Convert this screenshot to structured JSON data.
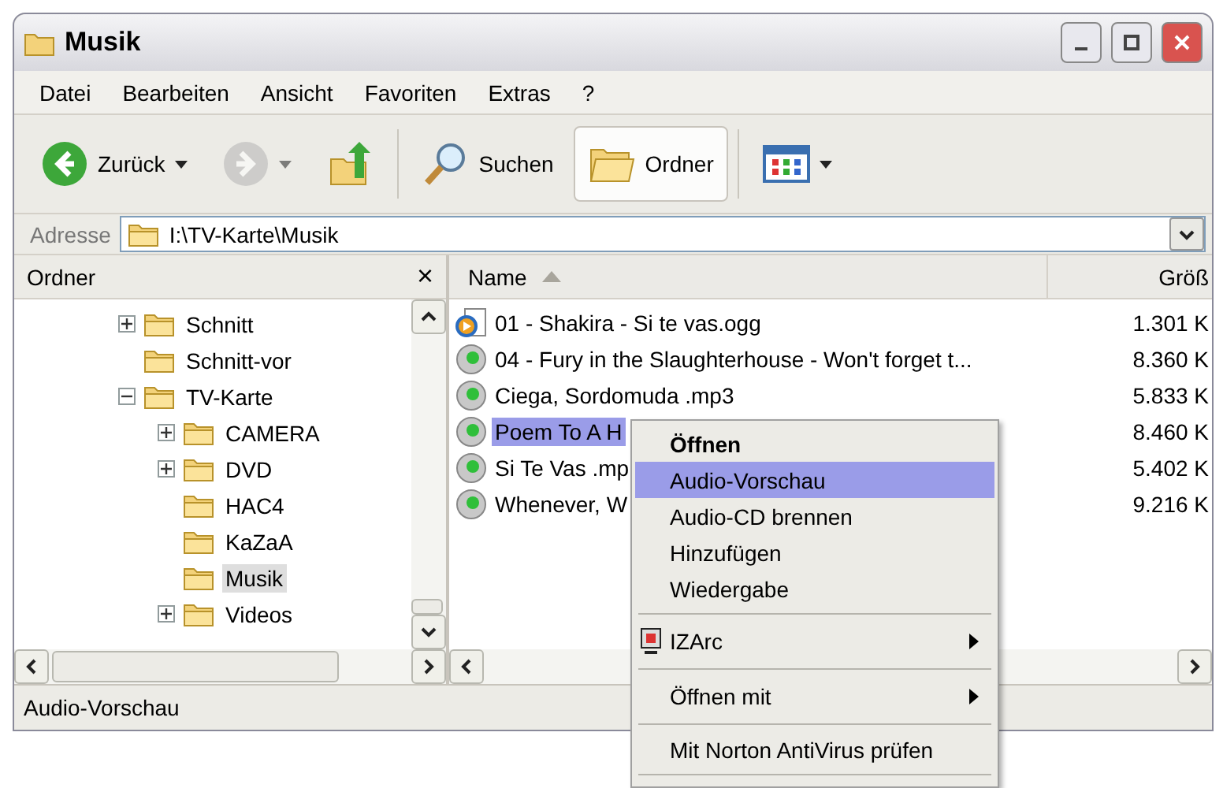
{
  "window": {
    "title": "Musik"
  },
  "menu_bar": [
    "Datei",
    "Bearbeiten",
    "Ansicht",
    "Favoriten",
    "Extras",
    "?"
  ],
  "toolbar": [
    {
      "kind": "back",
      "label": "Zurück",
      "dropdown": true,
      "disabled": false
    },
    {
      "kind": "forward",
      "dropdown": true,
      "disabled": true
    },
    {
      "kind": "up",
      "dropdown": false,
      "disabled": false
    },
    {
      "kind": "search",
      "label": "Suchen",
      "dropdown": false,
      "disabled": false
    },
    {
      "kind": "folders",
      "label": "Ordner",
      "dropdown": false,
      "disabled": false,
      "pressed": true
    },
    {
      "kind": "views",
      "dropdown": true,
      "disabled": false
    }
  ],
  "address": {
    "label": "Adresse",
    "value": "I:\\TV-Karte\\Musik"
  },
  "folder_pane": {
    "title": "Ordner",
    "close": "×",
    "items": [
      {
        "label": "Schnitt",
        "expandable": true,
        "expanded": false,
        "selected": false
      },
      {
        "label": "Schnitt-vor",
        "expandable": false,
        "selected": false
      },
      {
        "label": "TV-Karte",
        "expandable": true,
        "expanded": true,
        "selected": false,
        "children": [
          {
            "label": "CAMERA",
            "expandable": true,
            "expanded": false,
            "selected": false
          },
          {
            "label": "DVD",
            "expandable": true,
            "expanded": false,
            "selected": false
          },
          {
            "label": "HAC4",
            "expandable": false,
            "selected": false
          },
          {
            "label": "KaZaA",
            "expandable": false,
            "selected": false
          },
          {
            "label": "Musik",
            "expandable": false,
            "selected": true
          },
          {
            "label": "Videos",
            "expandable": true,
            "expanded": false,
            "selected": false
          }
        ]
      }
    ]
  },
  "file_list": {
    "columns": [
      {
        "label": "Name",
        "sorted": true
      },
      {
        "label": "Größ",
        "sorted": false
      }
    ],
    "rows": [
      {
        "name": "01 - Shakira - Si te vas.ogg",
        "size": "1.301 K",
        "kind": "ogg",
        "selected": false
      },
      {
        "name": "04 - Fury in the Slaughterhouse - Won't forget t...",
        "size": "8.360 K",
        "kind": "audio",
        "selected": false
      },
      {
        "name": "Ciega, Sordomuda .mp3",
        "size": "5.833 K",
        "kind": "audio",
        "selected": false
      },
      {
        "name": "Poem To A H",
        "size": "8.460 K",
        "kind": "audio",
        "selected": true
      },
      {
        "name": "Si Te Vas .mp",
        "size": "5.402 K",
        "kind": "audio",
        "selected": false
      },
      {
        "name": "Whenever, W",
        "size": "9.216 K",
        "kind": "audio",
        "selected": false
      }
    ]
  },
  "context_menu": [
    {
      "kind": "default",
      "label": "Öffnen",
      "selected": false
    },
    {
      "kind": "item",
      "label": "Audio-Vorschau",
      "selected": true
    },
    {
      "kind": "item",
      "label": "Audio-CD brennen",
      "selected": false
    },
    {
      "kind": "item",
      "label": "Hinzufügen",
      "selected": false
    },
    {
      "kind": "item",
      "label": "Wiedergabe",
      "selected": false
    },
    {
      "kind": "separator"
    },
    {
      "kind": "submenu",
      "label": "IZArc",
      "icon": true,
      "selected": false
    },
    {
      "kind": "separator"
    },
    {
      "kind": "submenu",
      "label": "Öffnen mit",
      "selected": false
    },
    {
      "kind": "separator"
    },
    {
      "kind": "item",
      "label": "Mit Norton AntiVirus prüfen",
      "selected": false
    },
    {
      "kind": "separator"
    }
  ],
  "status_bar": "Audio-Vorschau"
}
